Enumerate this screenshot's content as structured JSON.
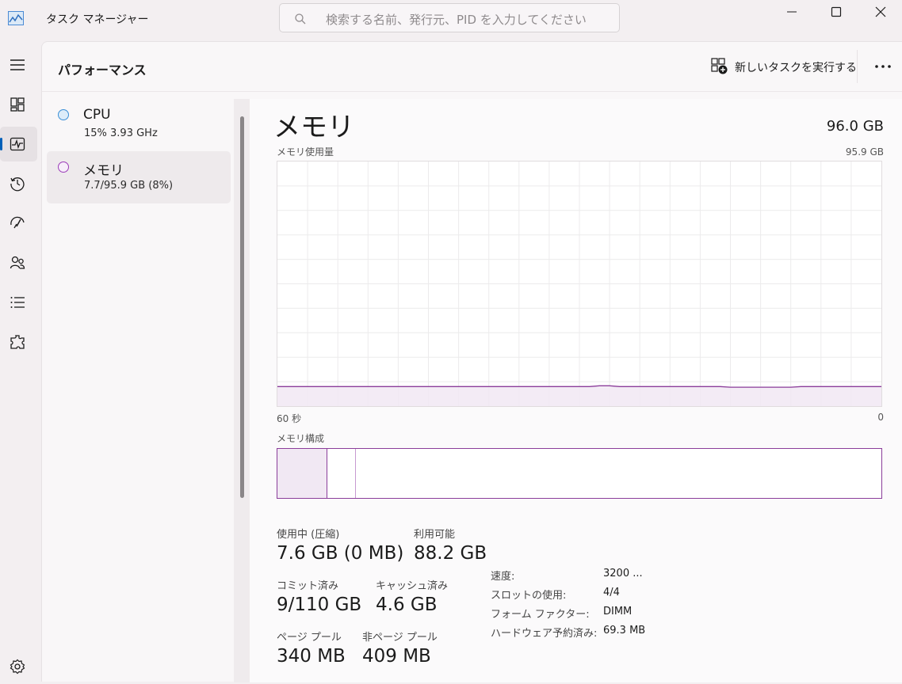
{
  "window": {
    "title": "タスク マネージャー",
    "search_placeholder": "検索する名前、発行元、PID を入力してください"
  },
  "nav": {
    "items": [
      {
        "name": "hamburger-icon"
      },
      {
        "name": "processes-icon"
      },
      {
        "name": "performance-icon",
        "active": true
      },
      {
        "name": "app-history-icon"
      },
      {
        "name": "startup-apps-icon"
      },
      {
        "name": "users-icon"
      },
      {
        "name": "details-icon"
      },
      {
        "name": "services-icon"
      },
      {
        "name": "settings-icon"
      }
    ]
  },
  "header": {
    "title": "パフォーマンス",
    "new_task": "新しいタスクを実行する"
  },
  "devices": [
    {
      "name": "CPU",
      "sub": "15% 3.93 GHz",
      "color": "#3a8fd6"
    },
    {
      "name": "メモリ",
      "sub": "7.7/95.9 GB (8%)",
      "color": "#9b3cb8"
    }
  ],
  "memory": {
    "title": "メモリ",
    "total": "96.0 GB",
    "usage_label": "メモリ使用量",
    "usage_max": "95.9 GB",
    "time_left": "60 秒",
    "time_right": "0",
    "composition_label": "メモリ構成",
    "graph_usage_fraction": 0.08,
    "stats": {
      "in_use_label": "使用中 (圧縮)",
      "in_use_value": "7.6 GB (0 MB)",
      "available_label": "利用可能",
      "available_value": "88.2 GB",
      "committed_label": "コミット済み",
      "committed_value": "9/110 GB",
      "cached_label": "キャッシュ済み",
      "cached_value": "4.6 GB",
      "paged_label": "ページ プール",
      "paged_value": "340 MB",
      "nonpaged_label": "非ページ プール",
      "nonpaged_value": "409 MB"
    },
    "specs": {
      "speed_label": "速度:",
      "speed_value": "3200 ...",
      "slots_label": "スロットの使用:",
      "slots_value": "4/4",
      "form_label": "フォーム ファクター:",
      "form_value": "DIMM",
      "reserved_label": "ハードウェア予約済み:",
      "reserved_value": "69.3 MB"
    }
  },
  "colors": {
    "accent": "#005fb8",
    "memory_line": "#8b3d9a",
    "memory_fill": "#f1e8f3"
  }
}
